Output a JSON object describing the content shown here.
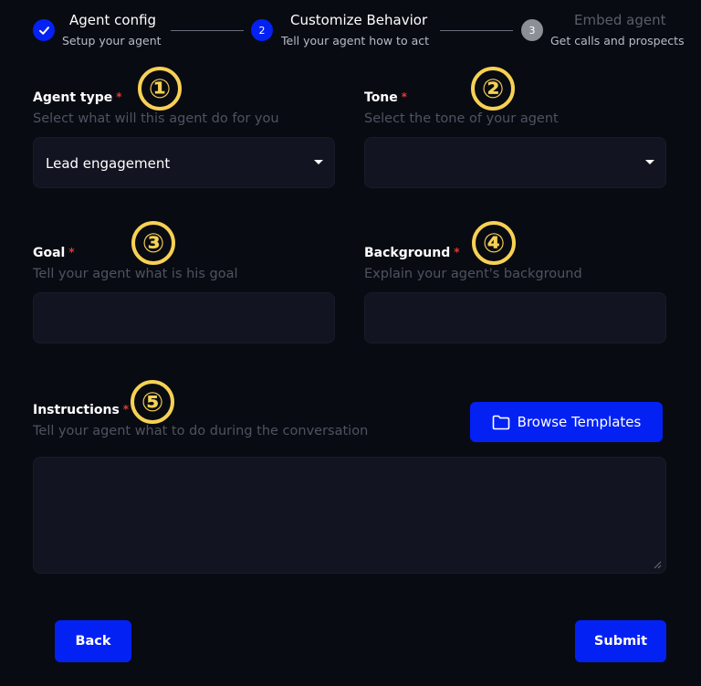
{
  "stepper": {
    "steps": [
      {
        "title": "Agent config",
        "subtitle": "Setup your agent",
        "number": "",
        "state": "complete"
      },
      {
        "title": "Customize Behavior",
        "subtitle": "Tell your agent how to act",
        "number": "2",
        "state": "active"
      },
      {
        "title": "Embed agent",
        "subtitle": "Get calls and prospects",
        "number": "3",
        "state": "pending"
      }
    ]
  },
  "annotations": [
    "①",
    "②",
    "③",
    "④",
    "⑤"
  ],
  "form": {
    "required_mark": "*",
    "agent_type": {
      "label": "Agent type",
      "hint": "Select what will this agent do for you",
      "value": "Lead engagement"
    },
    "tone": {
      "label": "Tone",
      "hint": "Select the tone of your agent",
      "value": ""
    },
    "goal": {
      "label": "Goal",
      "hint": "Tell your agent what is his goal",
      "value": ""
    },
    "background": {
      "label": "Background",
      "hint": "Explain your agent's background",
      "value": ""
    },
    "instructions": {
      "label": "Instructions",
      "hint": "Tell your agent what to do during the conversation",
      "value": ""
    }
  },
  "buttons": {
    "browse_templates": "Browse Templates",
    "back": "Back",
    "submit": "Submit"
  },
  "colors": {
    "background": "#090b12",
    "accent": "#0421f4",
    "annotation": "#f7d154",
    "required": "#e53935"
  }
}
